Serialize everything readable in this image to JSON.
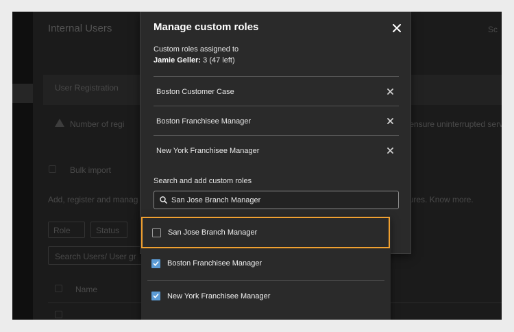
{
  "background": {
    "page_title": "Internal Users",
    "right_label": "Sc",
    "section_label": "User Registration",
    "warning_left": "Number of regi",
    "warning_right": "to ensure uninterrupted servi",
    "bulk_import": "Bulk import",
    "help_left": "Add, register and manag",
    "help_right": "gures. Know more.",
    "filter_1": "Role",
    "filter_2": "Status",
    "search_placeholder": "Search Users/ User gr",
    "column_name": "Name"
  },
  "modal": {
    "title": "Manage custom roles",
    "assigned_label": "Custom roles assigned to",
    "user_name": "Jamie Geller:",
    "assigned_count": "3 (47 left)",
    "assigned_roles": [
      {
        "label": "Boston Customer Case"
      },
      {
        "label": "Boston Franchisee Manager"
      },
      {
        "label": "New York Franchisee Manager"
      }
    ],
    "search_label": "Search and add custom roles",
    "search_value": "San Jose Branch Manager"
  },
  "dropdown": {
    "items": [
      {
        "label": "San Jose Branch Manager",
        "checked": false
      },
      {
        "label": "Boston Franchisee Manager",
        "checked": true
      },
      {
        "label": "New York Franchisee Manager",
        "checked": true
      }
    ]
  },
  "colors": {
    "accent_highlight": "#f0a030",
    "checkbox_checked": "#5b9bd5"
  }
}
